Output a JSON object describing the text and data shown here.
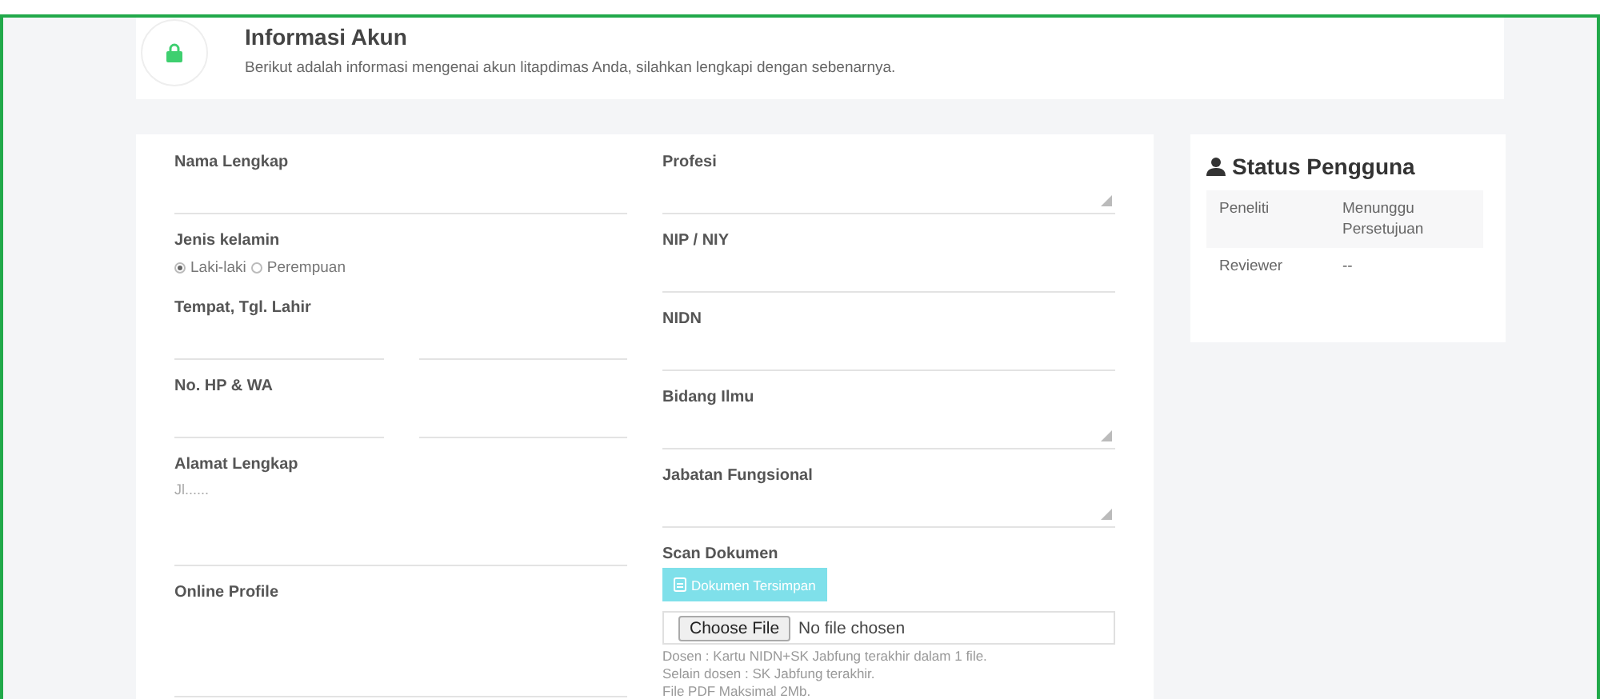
{
  "header": {
    "title": "Informasi Akun",
    "subtitle": "Berikut adalah informasi mengenai akun litapdimas Anda, silahkan lengkapi dengan sebenarnya."
  },
  "form": {
    "left": [
      {
        "kind": "text",
        "label": "Nama Lengkap"
      },
      {
        "kind": "radio",
        "label": "Jenis kelamin",
        "options": [
          {
            "label": "Laki-laki",
            "selected": true
          },
          {
            "label": "Perempuan",
            "selected": false
          }
        ]
      },
      {
        "kind": "pair",
        "label": "Tempat, Tgl. Lahir"
      },
      {
        "kind": "pair",
        "label": "No. HP & WA"
      },
      {
        "kind": "textarea",
        "label": "Alamat Lengkap",
        "placeholder": "Jl......"
      },
      {
        "kind": "textarea",
        "label": "Online Profile"
      }
    ],
    "right": [
      {
        "kind": "select",
        "label": "Profesi"
      },
      {
        "kind": "text",
        "label": "NIP / NIY"
      },
      {
        "kind": "text",
        "label": "NIDN"
      },
      {
        "kind": "select",
        "label": "Bidang Ilmu"
      },
      {
        "kind": "select",
        "label": "Jabatan Fungsional"
      },
      {
        "kind": "upload",
        "label": "Scan Dokumen",
        "button": "Dokumen Tersimpan",
        "file_button": "Choose File",
        "file_status": "No file chosen",
        "notes": [
          "Dosen : Kartu NIDN+SK Jabfung terakhir dalam 1 file.",
          "Selain dosen : SK Jabfung terakhir.",
          "File PDF Maksimal 2Mb."
        ]
      }
    ]
  },
  "status": {
    "title": "Status Pengguna",
    "rows": [
      {
        "role": "Peneliti",
        "value": "Menunggu Persetujuan"
      },
      {
        "role": "Reviewer",
        "value": "--"
      }
    ]
  }
}
